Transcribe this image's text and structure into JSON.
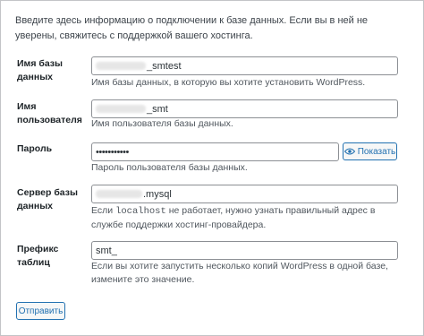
{
  "intro": "Введите здесь информацию о подключении к базе данных. Если вы в ней не уверены, свяжитесь с поддержкой вашего хостинга.",
  "fields": {
    "dbname": {
      "label": "Имя базы данных",
      "value": "_smtest",
      "description": "Имя базы данных, в которую вы хотите установить WordPress."
    },
    "uname": {
      "label": "Имя пользователя",
      "value": "_smt",
      "description": "Имя пользователя базы данных."
    },
    "pwd": {
      "label": "Пароль",
      "value": "•••••••••••",
      "description": "Пароль пользователя базы данных.",
      "show_label": "Показать"
    },
    "dbhost": {
      "label": "Сервер базы данных",
      "value": ".mysql",
      "description_prefix": "Если",
      "description_code": "localhost",
      "description_suffix": "не работает, нужно узнать правильный адрес в службе поддержки хостинг-провайдера."
    },
    "prefix": {
      "label": "Префикс таблиц",
      "value": "smt_",
      "description": "Если вы хотите запустить несколько копий WordPress в одной базе, измените это значение."
    }
  },
  "submit_label": "Отправить",
  "colors": {
    "accent": "#2271b1",
    "border": "#8c8f94",
    "desc": "#50575e"
  },
  "icons": {
    "show_password": "eye-icon"
  }
}
